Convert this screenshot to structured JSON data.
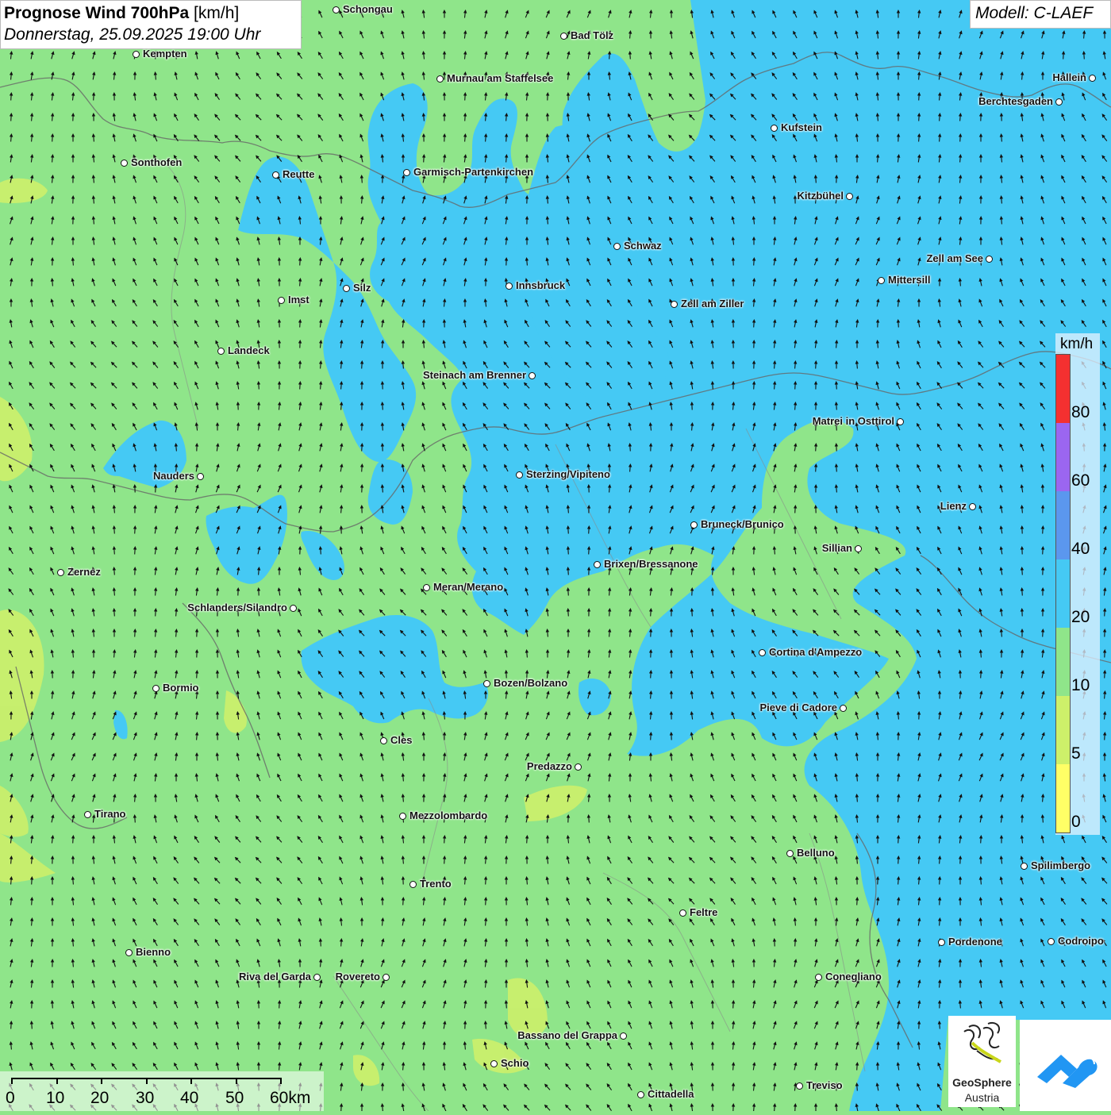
{
  "header": {
    "title_bold": "Prognose Wind 700hPa",
    "title_unit": "[km/h]",
    "subtitle": "Donnerstag, 25.09.2025 19:00 Uhr",
    "model": "Modell: C-LAEF"
  },
  "legend": {
    "unit": "km/h",
    "labels": [
      "80",
      "60",
      "40",
      "20",
      "10",
      "5",
      "0"
    ],
    "colors": [
      "#f43030",
      "#9b66f0",
      "#5b97ee",
      "#45c9f4",
      "#8fe58a",
      "#cdf06a",
      "#ffff66"
    ]
  },
  "scalebar": {
    "labels": [
      "0",
      "10",
      "20",
      "30",
      "40",
      "50",
      "60km"
    ]
  },
  "logos": {
    "geosphere_name": "GeoSphere",
    "geosphere_sub": "Austria"
  },
  "colors": {
    "low_wind": "#8fe58a",
    "mid_wind": "#45c9f4",
    "very_low_wind": "#cdf06a",
    "border": "#666666"
  },
  "cities": [
    {
      "name": "Schongau"
    },
    {
      "name": "Bad Tölz"
    },
    {
      "name": "Kempten"
    },
    {
      "name": "Murnau am Staffelsee"
    },
    {
      "name": "Hallein"
    },
    {
      "name": "Berchtesgaden"
    },
    {
      "name": "Kufstein"
    },
    {
      "name": "Sonthofen"
    },
    {
      "name": "Reutte"
    },
    {
      "name": "Garmisch-Partenkirchen"
    },
    {
      "name": "Kitzbühel"
    },
    {
      "name": "Schwaz"
    },
    {
      "name": "Zell am See"
    },
    {
      "name": "Mittersill"
    },
    {
      "name": "Innsbruck"
    },
    {
      "name": "Silz"
    },
    {
      "name": "Imst"
    },
    {
      "name": "Zell am Ziller"
    },
    {
      "name": "Landeck"
    },
    {
      "name": "Steinach am Brenner"
    },
    {
      "name": "Matrei in Osttirol"
    },
    {
      "name": "Nauders"
    },
    {
      "name": "Sterzing/Vipiteno"
    },
    {
      "name": "Lienz"
    },
    {
      "name": "Bruneck/Brunico"
    },
    {
      "name": "Sillian"
    },
    {
      "name": "Zernez"
    },
    {
      "name": "Brixen/Bressanone"
    },
    {
      "name": "Meran/Merano"
    },
    {
      "name": "Schlanders/Silandro"
    },
    {
      "name": "Cortina d'Ampezzo"
    },
    {
      "name": "Bozen/Bolzano"
    },
    {
      "name": "Bormio"
    },
    {
      "name": "Pieve di Cadore"
    },
    {
      "name": "Cles"
    },
    {
      "name": "Predazzo"
    },
    {
      "name": "Tirano"
    },
    {
      "name": "Mezzolombardo"
    },
    {
      "name": "Belluno"
    },
    {
      "name": "Spilimbergo"
    },
    {
      "name": "Trento"
    },
    {
      "name": "Feltre"
    },
    {
      "name": "Pordenone"
    },
    {
      "name": "Codroipo"
    },
    {
      "name": "Bienno"
    },
    {
      "name": "Riva del Garda"
    },
    {
      "name": "Rovereto"
    },
    {
      "name": "Conegliano"
    },
    {
      "name": "Bassano del Grappa"
    },
    {
      "name": "Schio"
    },
    {
      "name": "Treviso"
    },
    {
      "name": "Cittadella"
    }
  ]
}
